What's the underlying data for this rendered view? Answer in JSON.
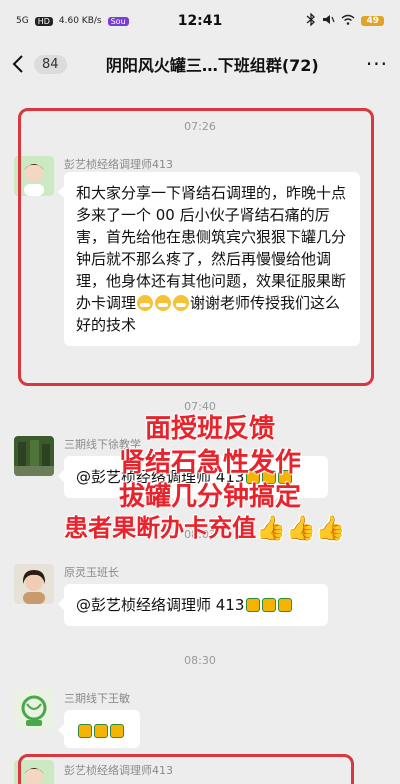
{
  "status_bar": {
    "network_1": "5G",
    "network_2": "HD",
    "speed": "4.60 KB/s",
    "app_badge": "Sou",
    "time": "12:41",
    "battery": "49"
  },
  "nav": {
    "unread_count": "84",
    "title": "阴阳风火罐三…下班组群(72)"
  },
  "messages": [
    {
      "time": "07:26",
      "sender": "彭艺桢经络调理师413",
      "text": "和大家分享一下肾结石调理的，昨晚十点多来了一个 00 后小伙子肾结石痛的厉害，首先给他在患侧筑宾穴狠狠下罐几分钟后就不那么疼了，然后再慢慢给他调理，他身体还有其他问题，效果征服果断办卡调理",
      "text_tail": "谢谢老师传授我们这么好的技术"
    },
    {
      "time": "07:40",
      "sender": "三期线下徐教学",
      "text": "@彭艺桢经络调理师 413"
    },
    {
      "time": "08:03",
      "sender": "原灵玉班长",
      "text": "@彭艺桢经络调理师 413"
    },
    {
      "time": "08:30",
      "sender": "三期线下王敏",
      "text": ""
    },
    {
      "sender": "彭艺桢经络调理师413"
    }
  ],
  "overlay": {
    "line1": "面授班反馈",
    "line2": "肾结石急性发作",
    "line3": "拔罐几分钟搞定",
    "line4": "患者果断办卡充值👍👍👍"
  },
  "colors": {
    "highlight": "#d9363e",
    "overlay_text": "#e8232b",
    "chat_bg": "#ededed"
  }
}
